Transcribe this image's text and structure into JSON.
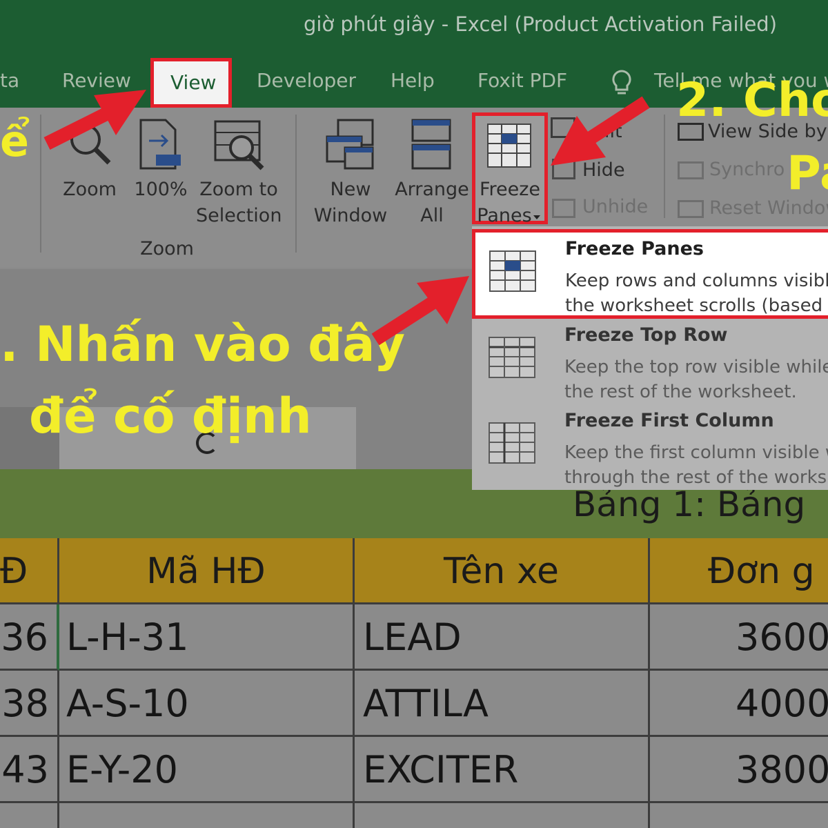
{
  "window": {
    "title": "giờ phút giây  -  Excel (Product Activation Failed)"
  },
  "tabs": [
    {
      "label": "ta"
    },
    {
      "label": "Review"
    },
    {
      "label": "View"
    },
    {
      "label": "Developer"
    },
    {
      "label": "Help"
    },
    {
      "label": "Foxit PDF"
    },
    {
      "label": "Tell me what you w"
    }
  ],
  "ribbon": {
    "zoom_group": {
      "zoom": "Zoom",
      "hundred": "100%",
      "zoom_to": "Zoom to",
      "selection": "Selection",
      "group_label": "Zoom"
    },
    "window_group": {
      "new": "New",
      "window": "Window",
      "arrange": "Arrange",
      "all": "All",
      "freeze": "Freeze",
      "panes": "Panes",
      "split": "lit",
      "hide": "Hide",
      "unhide": "Unhide",
      "view_side": "View Side by S",
      "synchro": "Synchro",
      "reset": "Reset Window"
    }
  },
  "dropdown": {
    "items": [
      {
        "title": "Freeze Panes",
        "desc": "Keep rows and columns visible\nthe worksheet scrolls (based o"
      },
      {
        "title": "Freeze Top Row",
        "desc": "Keep the top row visible while\nthe rest of the worksheet."
      },
      {
        "title": "Freeze First Column",
        "desc": "Keep the first column visible w\nthrough the rest of the worksh"
      }
    ]
  },
  "annotations": {
    "step1_left": "ể",
    "step2_line1": "2. Cho",
    "step2_line2": "Pa",
    "step3_line1": ". Nhấn vào đây",
    "step3_line2": "để cố định"
  },
  "sheet": {
    "caption": "Bảng 1: Bảng",
    "headers": [
      "Đ",
      "Mã HĐ",
      "Tên xe",
      "Đơn g"
    ],
    "rows": [
      [
        "36",
        "L-H-31",
        "LEAD",
        "3600"
      ],
      [
        "38",
        "A-S-10",
        "ATTILA",
        "4000"
      ],
      [
        "43",
        "E-Y-20",
        "EXCITER",
        "3800"
      ]
    ]
  },
  "colors": {
    "excel_green": "#1c5d32",
    "highlight_red": "#e3202b",
    "annotation_yellow": "#f3ee2a",
    "header_gold": "#a7831a"
  }
}
